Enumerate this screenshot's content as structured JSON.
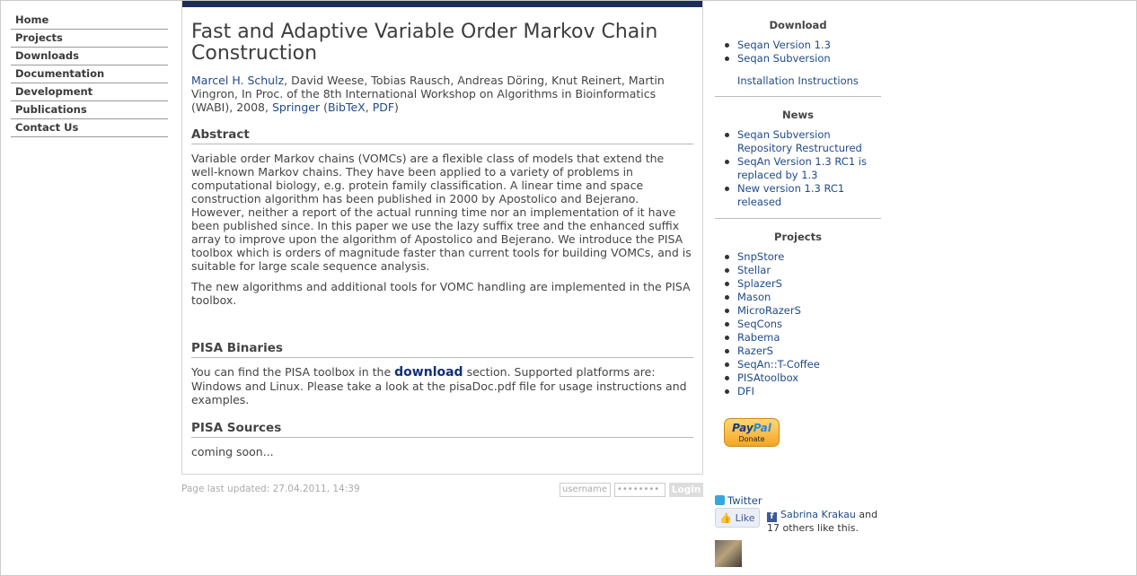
{
  "nav": {
    "items": [
      "Home",
      "Projects",
      "Downloads",
      "Documentation",
      "Development",
      "Publications",
      "Contact Us"
    ]
  },
  "main": {
    "title": "Fast and Adaptive Variable Order Markov Chain Construction",
    "citation": {
      "author_link": "Marcel H. Schulz",
      "rest": ", David Weese, Tobias Rausch, Andreas Döring, Knut Reinert, Martin Vingron, In Proc. of the 8th International Workshop on Algorithms in Bioinformatics (WABI), 2008, ",
      "springer": "Springer",
      "open_paren": " (",
      "bibtex": "BibTeX",
      "comma": ", ",
      "pdf": "PDF",
      "close_paren": ")"
    },
    "abstract": {
      "heading": "Abstract",
      "p1": "Variable order Markov chains (VOMCs) are a flexible class of models that extend the well-known Markov chains. They have been applied to a variety of problems in computational biology, e.g. protein family classification. A linear time and space construction algorithm has been published in 2000 by Apostolico and Bejerano. However, neither a report of the actual running time nor an implementation of it have been published since. In this paper we use the lazy suffix tree and the enhanced suffix array to improve upon the algorithm of Apostolico and Bejerano. We introduce the PISA toolbox which is orders of magnitude faster than current tools for building VOMCs, and is suitable for large scale sequence analysis.",
      "p2": "The new algorithms and additional tools for VOMC handling are implemented in the PISA toolbox."
    },
    "binaries": {
      "heading": "PISA Binaries",
      "before": "You can find the PISA toolbox in the ",
      "link": "download",
      "after": " section. Supported platforms are: Windows and Linux. Please take a look at the pisaDoc.pdf file for usage instructions and examples."
    },
    "sources": {
      "heading": "PISA Sources",
      "text": "coming soon..."
    }
  },
  "footer": {
    "updated": "Page last updated: 27.04.2011, 14:39",
    "username_placeholder": "username",
    "password_placeholder": "••••••••",
    "login": "Login"
  },
  "sidebar": {
    "download": {
      "heading": "Download",
      "items": [
        "Seqan Version 1.3",
        "Seqan Subversion"
      ],
      "extra": "Installation Instructions"
    },
    "news": {
      "heading": "News",
      "items": [
        "Seqan Subversion Repository Restructured",
        "SeqAn Version 1.3 RC1 is replaced by 1.3",
        "New version 1.3 RC1 released"
      ]
    },
    "projects": {
      "heading": "Projects",
      "items": [
        "SnpStore",
        "Stellar",
        "SplazerS",
        "Mason",
        "MicroRazerS",
        "SeqCons",
        "Rabema",
        "RazerS",
        "SeqAn::T-Coffee",
        "PISAtoolbox",
        "DFI"
      ]
    },
    "paypal": {
      "brand_a": "Pay",
      "brand_b": "Pal",
      "donate": "Donate"
    },
    "twitter": "Twitter",
    "like": "Like",
    "fb_name": "Sabrina Krakau",
    "fb_rest": " and 17 others like this."
  }
}
